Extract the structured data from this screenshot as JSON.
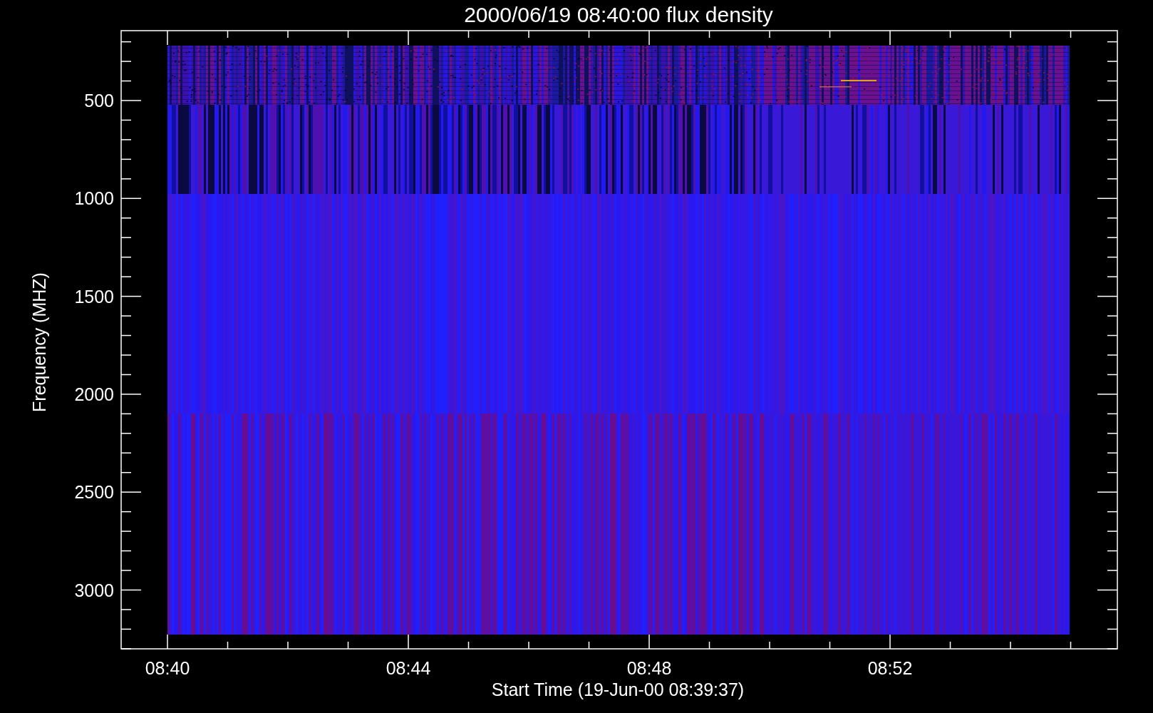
{
  "title": "2000/06/19 08:40:00 flux density",
  "x_axis": {
    "label": "Start Time (19-Jun-00 08:39:37)",
    "ticks": [
      "08:40",
      "08:44",
      "08:48",
      "08:52"
    ]
  },
  "y_axis": {
    "label": "Frequency (MHZ)",
    "ticks": [
      "500",
      "1000",
      "1500",
      "2000",
      "2500",
      "3000"
    ]
  }
}
